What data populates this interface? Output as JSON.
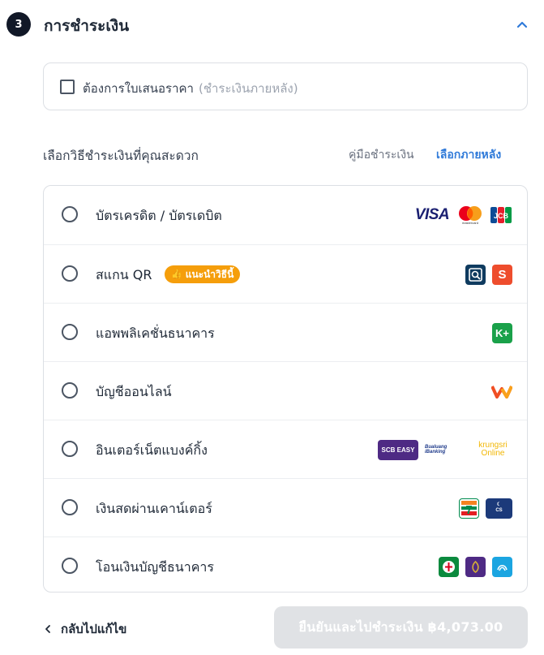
{
  "section": {
    "step": "3",
    "title": "การชำระเงิน"
  },
  "quote": {
    "label": "ต้องการใบเสนอราคา",
    "hint": "(ชำระเงินภายหลัง)"
  },
  "choose": {
    "label": "เลือกวิธีชำระเงินที่คุณสะดวก",
    "guide": "คู่มือชำระเงิน",
    "later": "เลือกภายหลัง"
  },
  "methods": [
    {
      "label": "บัตรเครดิต / บัตรเดบิต",
      "logos": [
        "VISA",
        "mastercard",
        "JCB"
      ]
    },
    {
      "label": "สแกน QR",
      "badge": "แนะนำวิธีนี้",
      "logos": [
        "qr-scan-icon",
        "shopee-pay-icon"
      ]
    },
    {
      "label": "แอพพลิเคชั่นธนาคาร",
      "logos": [
        "K+"
      ]
    },
    {
      "label": "บัญชีออนไลน์",
      "logos": [
        "w-wallet-icon"
      ]
    },
    {
      "label": "อินเตอร์เน็ตแบงค์กิ้ง",
      "logos": [
        "SCB EASY",
        "Bualuang iBanking",
        "krungsri Online"
      ]
    },
    {
      "label": "เงินสดผ่านเคาน์เตอร์",
      "logos": [
        "7-eleven-icon",
        "counter-service-icon"
      ]
    },
    {
      "label": "โอนเงินบัญชีธนาคาร",
      "logos": [
        "kbank-icon",
        "scb-icon",
        "ktb-icon"
      ]
    }
  ],
  "footer": {
    "back": "กลับไปแก้ไข",
    "confirm": "ยืนยันและไปชำระเงิน ฿4,073.00"
  },
  "colors": {
    "accent": "#2f7ad9",
    "badge": "#f59e0b",
    "disabled": "#e0e2e5"
  }
}
